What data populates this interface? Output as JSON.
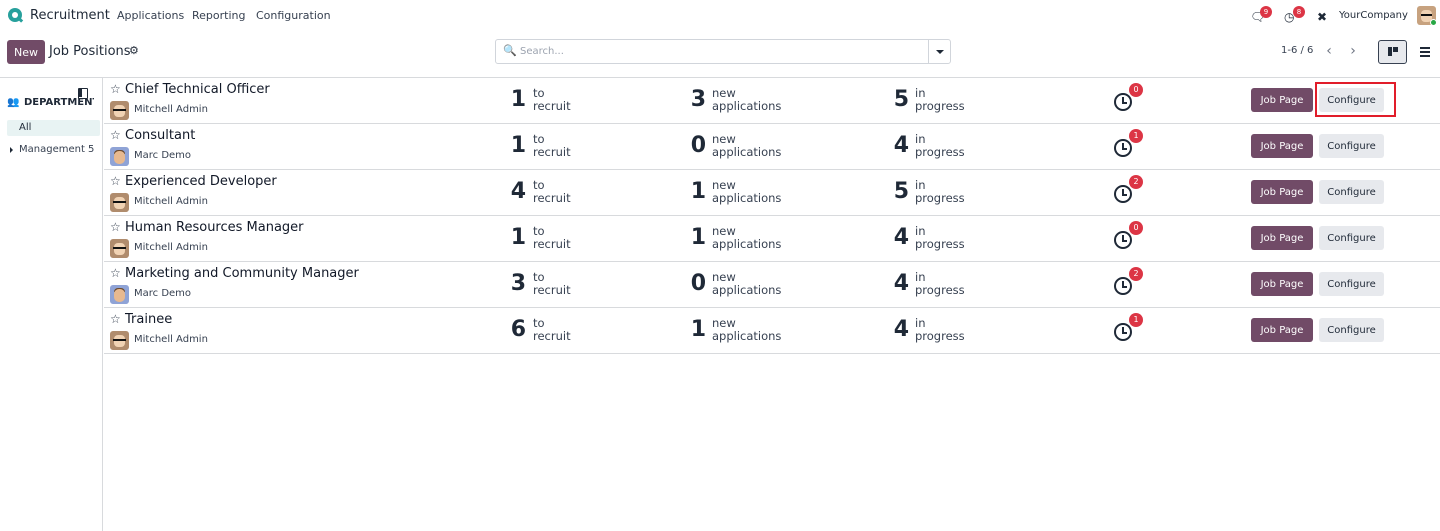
{
  "navbar": {
    "app_name": "Recruitment",
    "menu": [
      "Applications",
      "Reporting",
      "Configuration"
    ],
    "messages_count": "9",
    "activities_count": "8",
    "company": "YourCompany"
  },
  "control_panel": {
    "new_label": "New",
    "title": "Job Positions",
    "search_placeholder": "Search...",
    "pager": "1-6 / 6"
  },
  "sidebar": {
    "header": "DEPARTMENT",
    "all_label": "All",
    "items": [
      {
        "label": "Management",
        "count": "5"
      }
    ]
  },
  "labels": {
    "to_recruit": [
      "to",
      "recruit"
    ],
    "new_applications": [
      "new",
      "applications"
    ],
    "in_progress": [
      "in",
      "progress"
    ],
    "job_page": "Job Page",
    "configure": "Configure"
  },
  "jobs": [
    {
      "title": "Chief Technical Officer",
      "manager": "Mitchell Admin",
      "avatar": "mitchell",
      "to_recruit": "1",
      "new_applications": "3",
      "in_progress": "5",
      "activities": "0"
    },
    {
      "title": "Consultant",
      "manager": "Marc Demo",
      "avatar": "marc",
      "to_recruit": "1",
      "new_applications": "0",
      "in_progress": "4",
      "activities": "1"
    },
    {
      "title": "Experienced Developer",
      "manager": "Mitchell Admin",
      "avatar": "mitchell",
      "to_recruit": "4",
      "new_applications": "1",
      "in_progress": "5",
      "activities": "2"
    },
    {
      "title": "Human Resources Manager",
      "manager": "Mitchell Admin",
      "avatar": "mitchell",
      "to_recruit": "1",
      "new_applications": "1",
      "in_progress": "4",
      "activities": "0"
    },
    {
      "title": "Marketing and Community Manager",
      "manager": "Marc Demo",
      "avatar": "marc",
      "to_recruit": "3",
      "new_applications": "0",
      "in_progress": "4",
      "activities": "2"
    },
    {
      "title": "Trainee",
      "manager": "Mitchell Admin",
      "avatar": "mitchell",
      "to_recruit": "6",
      "new_applications": "1",
      "in_progress": "4",
      "activities": "1"
    }
  ],
  "colors": {
    "primary": "#714b67",
    "highlight": "#e11d2a",
    "badge": "#dc3545"
  }
}
